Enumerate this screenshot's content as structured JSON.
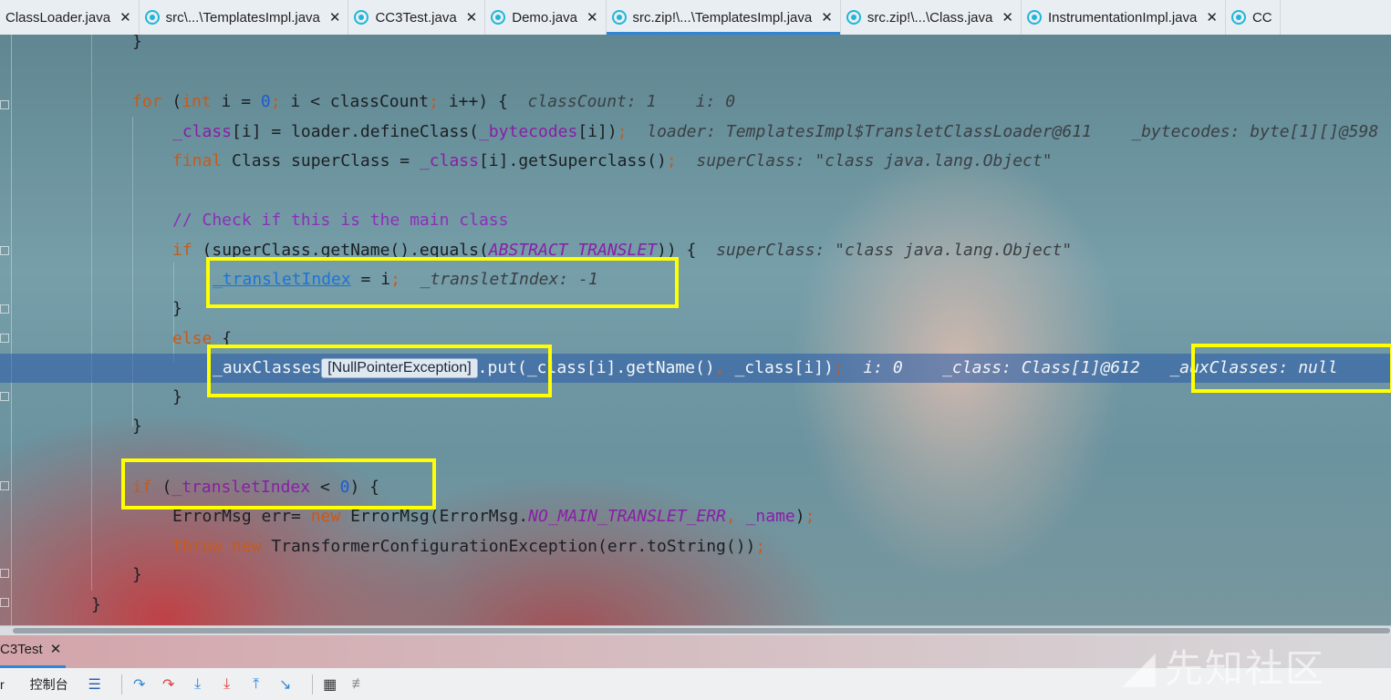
{
  "tabs": [
    {
      "label": "ClassLoader.java",
      "icon": "none",
      "active": false
    },
    {
      "label": "src\\...\\TemplatesImpl.java",
      "icon": "class-icon",
      "active": false
    },
    {
      "label": "CC3Test.java",
      "icon": "class-icon",
      "active": false
    },
    {
      "label": "Demo.java",
      "icon": "class-icon",
      "active": false
    },
    {
      "label": "src.zip!\\...\\TemplatesImpl.java",
      "icon": "class-icon",
      "active": true
    },
    {
      "label": "src.zip!\\...\\Class.java",
      "icon": "class-icon",
      "active": false
    },
    {
      "label": "InstrumentationImpl.java",
      "icon": "class-icon",
      "active": false
    },
    {
      "label": "CC",
      "icon": "class-icon",
      "active": false
    }
  ],
  "tab_close_glyph": "✕",
  "code": {
    "l1": {
      "brace": "}"
    },
    "l2": {
      "for": "for",
      "open": " (",
      "int": "int",
      "mid1": " i = ",
      "zero": "0",
      "semi1": ";",
      "mid2": " i < classCount",
      "semi2": ";",
      "mid3": " i++) {",
      "hint": "classCount: 1    i: 0"
    },
    "l3": {
      "f1": "_class",
      "p1": "[i] = loader.defineClass(",
      "f2": "_bytecodes",
      "p2": "[i])",
      "semi": ";",
      "hint": "loader: TemplatesImpl$TransletClassLoader@611    _bytecodes: byte[1][]@598"
    },
    "l4": {
      "final": "final",
      "p1": " Class superClass = ",
      "f1": "_class",
      "p2": "[i].getSuperclass()",
      "semi": ";",
      "hint": "superClass: \"class java.lang.Object\""
    },
    "l5": {
      "comment": "// Check if this is the main class"
    },
    "l6": {
      "if": "if",
      "p1": " (superClass.getName().equals(",
      "cst": "ABSTRACT_TRANSLET",
      "p2": ")) {",
      "hint": "superClass: \"class java.lang.Object\""
    },
    "l7": {
      "f1": "_transletIndex",
      "p1": " = i",
      "semi": ";",
      "hint": "_transletIndex: -1"
    },
    "l8": {
      "brace": "}"
    },
    "l9": {
      "else": "else",
      "p1": " {"
    },
    "l10": {
      "f1": "_auxClasses",
      "badge": "[NullPointerException]",
      "p1": ".put(",
      "f2": "_class",
      "p2": "[i].getName()",
      "comma": ",",
      "p3": " ",
      "f3": "_class",
      "p4": "[i])",
      "semi": ";",
      "hint1": "i: 0    _class: Class[1]@612",
      "hint2": "_auxClasses: null"
    },
    "l11": {
      "brace": "}"
    },
    "l12": {
      "brace": "}"
    },
    "l13": {
      "if": "if",
      "p1": " (",
      "f1": "_transletIndex",
      "p2": " < ",
      "zero": "0",
      "p3": ") {"
    },
    "l14": {
      "p1": "ErrorMsg err= ",
      "new": "new",
      "p2": " ErrorMsg(ErrorMsg.",
      "cst": "NO_MAIN_TRANSLET_ERR",
      "comma": ",",
      "p3": " ",
      "f1": "_name",
      "p4": ")",
      "semi": ";"
    },
    "l15": {
      "throw": "throw",
      "sp": " ",
      "new": "new",
      "p1": " TransformerConfigurationException(err.toString())",
      "semi": ";"
    },
    "l16": {
      "brace": "}"
    },
    "l17": {
      "brace": "}"
    }
  },
  "debug": {
    "session_tab": "C3Test",
    "toolbar_text_1": "r",
    "toolbar_text_2": "控制台"
  },
  "watermark": {
    "text": "先知社区"
  },
  "colors": {
    "highlight": "#ffff00",
    "tab_active": "#2f86d6"
  }
}
